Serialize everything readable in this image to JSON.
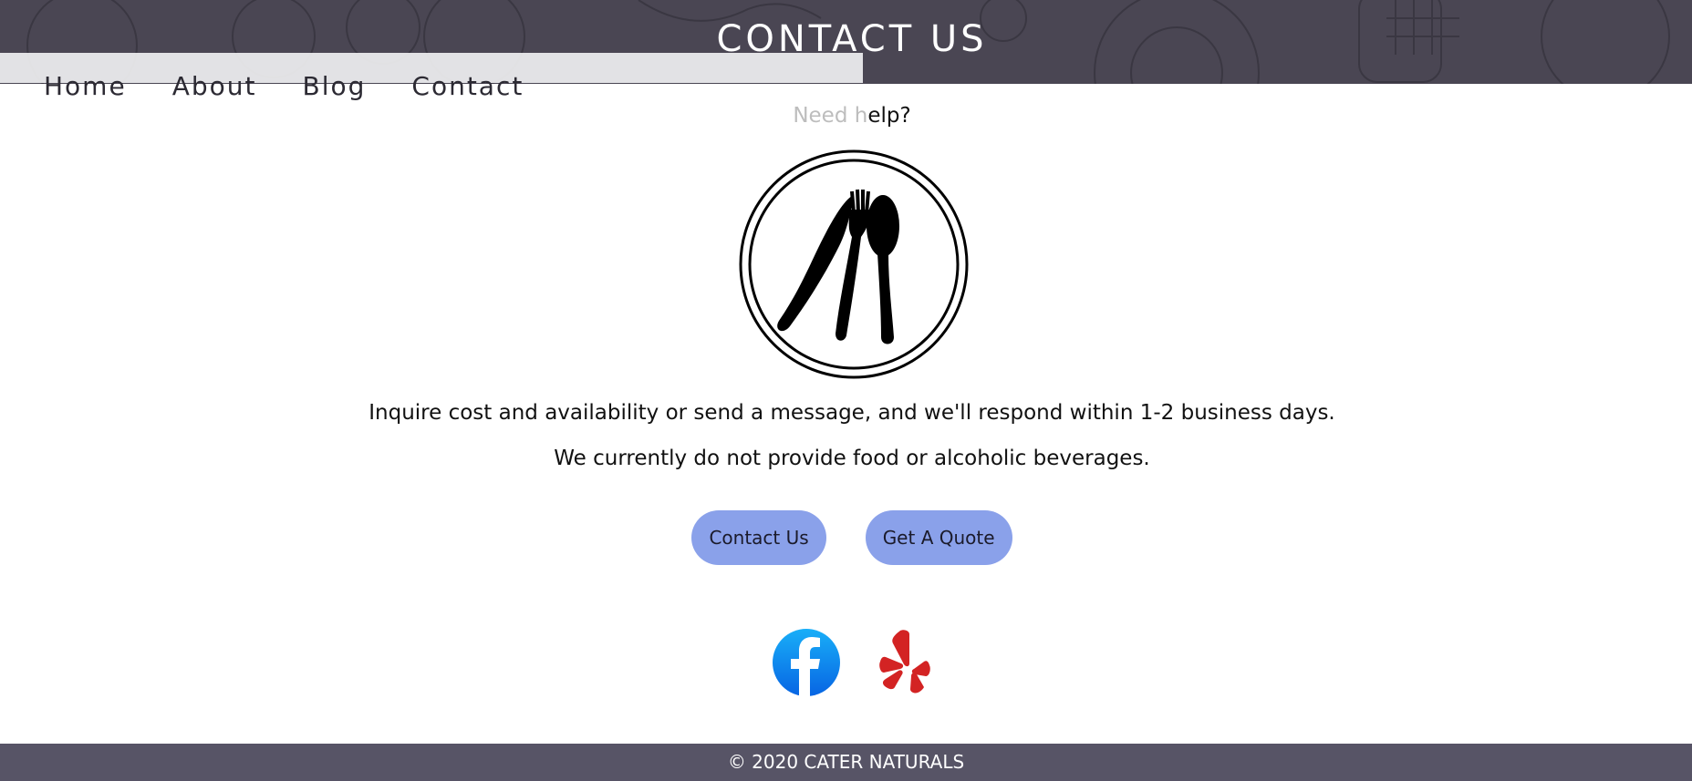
{
  "banner": {
    "title": "CONTACT US"
  },
  "nav": {
    "items": [
      {
        "label": "Home"
      },
      {
        "label": "About"
      },
      {
        "label": "Blog"
      },
      {
        "label": "Contact"
      }
    ]
  },
  "main": {
    "need_help_faded": "Need h",
    "need_help_rest": "elp?",
    "logo_icon": "utensils-plate-icon",
    "line1": "Inquire cost and availability or send a message, and we'll respond within 1-2 business days.",
    "line2": "We currently do not provide food or alcoholic beverages.",
    "buttons": {
      "contact": "Contact Us",
      "quote": "Get A Quote"
    },
    "social": {
      "facebook_icon": "facebook-icon",
      "yelp_icon": "yelp-icon"
    }
  },
  "footer": {
    "text": "© 2020 CATER NATURALS"
  },
  "colors": {
    "banner_bg": "#4a4653",
    "footer_bg": "#575466",
    "button_bg": "#8aa1ea",
    "facebook_blue": "#1877f2",
    "yelp_red": "#d32323"
  }
}
